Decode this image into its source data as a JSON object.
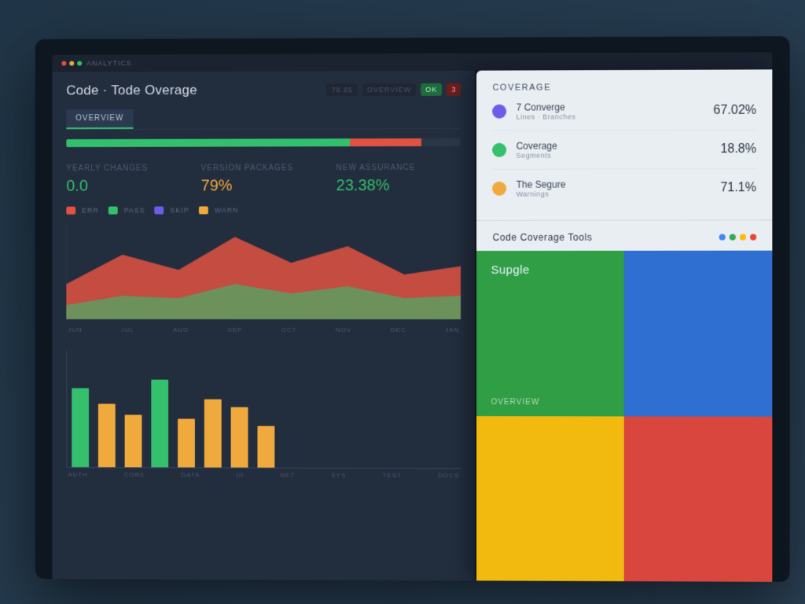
{
  "window": {
    "titlebar_label": "Analytics",
    "title": "Code · Tode Overage"
  },
  "header_actions": {
    "a1": "78.85",
    "a2": "Overview",
    "pill_ok": "OK",
    "pill_err": "3"
  },
  "tabs": {
    "active": "Overview"
  },
  "progress": {
    "green_pct": 72,
    "red_pct": 18,
    "rest_pct": 10
  },
  "metrics": [
    {
      "label": "Yearly Changes",
      "value": "0.0",
      "tone": "g"
    },
    {
      "label": "Version Packages",
      "value": "79%",
      "tone": "y"
    },
    {
      "label": "New Assurance",
      "value": "23.38%",
      "tone": "g"
    }
  ],
  "chips": [
    {
      "color": "r",
      "label": "Err"
    },
    {
      "color": "g",
      "label": "Pass"
    },
    {
      "color": "b",
      "label": "Skip"
    },
    {
      "color": "y",
      "label": "Warn"
    }
  ],
  "chart_data": [
    {
      "type": "area",
      "title": "",
      "series": [
        {
          "name": "errors",
          "color": "#e15241",
          "x": [
            0,
            1,
            2,
            3,
            4,
            5,
            6,
            7
          ],
          "values": [
            30,
            55,
            42,
            70,
            48,
            62,
            38,
            45
          ]
        },
        {
          "name": "pass",
          "color": "#34c06c",
          "x": [
            0,
            1,
            2,
            3,
            4,
            5,
            6,
            7
          ],
          "values": [
            12,
            20,
            18,
            30,
            22,
            28,
            18,
            20
          ]
        }
      ],
      "categories": [
        "Jun",
        "Jul",
        "Aug",
        "Sep",
        "Oct",
        "Nov",
        "Dec",
        "Jan"
      ],
      "xlabel": "",
      "ylabel": "",
      "ylim": [
        0,
        80
      ]
    },
    {
      "type": "bar",
      "title": "",
      "categories": [
        "Auth",
        "Core",
        "Data",
        "UI",
        "Net",
        "Sys",
        "Test",
        "Docs"
      ],
      "series": [
        {
          "name": "coverage",
          "values": [
            72,
            58,
            48,
            80,
            44,
            62,
            55,
            38
          ],
          "colors": [
            "g",
            "y",
            "y",
            "g",
            "y",
            "y",
            "y",
            "y"
          ]
        }
      ],
      "xlabel": "",
      "ylabel": "",
      "ylim": [
        0,
        100
      ]
    }
  ],
  "right": {
    "header": "Coverage",
    "items": [
      {
        "badge": "p",
        "name": "7 Converge",
        "sub": "Lines · Branches",
        "value": "67.02%"
      },
      {
        "badge": "g",
        "name": "Coverage",
        "sub": "Segments",
        "value": "18.8%"
      },
      {
        "badge": "y",
        "name": "The Segure",
        "sub": "Warnings",
        "value": "71.1%"
      }
    ],
    "subhead": "Code Coverage Tools",
    "quad": {
      "tl": {
        "label": "Supgle",
        "sub": "Overview"
      },
      "tr": {
        "label": "",
        "sub": ""
      },
      "bl": {
        "label": "",
        "sub": ""
      },
      "br": {
        "label": "",
        "sub": ""
      }
    }
  }
}
